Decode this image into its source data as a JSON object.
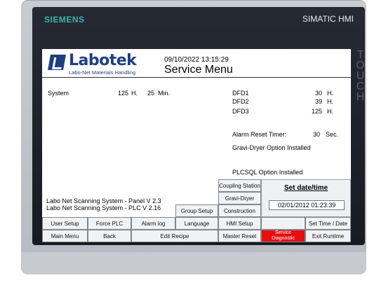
{
  "bezel": {
    "brand_left": "SIEMENS",
    "brand_right": "SIMATIC HMI",
    "side_label": "TOUCH"
  },
  "header": {
    "logo_name": "Labotek",
    "logo_tagline": "Labo-Net Materials Handling",
    "datetime": "09/10/2022 13:15:29",
    "title": "Service Menu"
  },
  "status": {
    "system_label": "System",
    "system_hours": "125",
    "hours_unit": "H.",
    "system_minutes": "25",
    "minutes_unit": "Min.",
    "dfd": [
      {
        "label": "DFD1",
        "value": "30",
        "unit": "H."
      },
      {
        "label": "DFD2",
        "value": "39",
        "unit": "H."
      },
      {
        "label": "DFD3",
        "value": "125",
        "unit": "H."
      }
    ],
    "alarm_label": "Alarm Reset Timer:",
    "alarm_value": "30",
    "alarm_unit": "Sec.",
    "gravi_option": "Gravi-Dryer Option Installed",
    "plcsql_option": "PLCSQL Option Installed"
  },
  "versions": {
    "panel": "Labo Net Scanning System - Panel V 2.3",
    "plc": "Labo Net Scanning System - PLC V 2.16"
  },
  "side_buttons": {
    "coupling": "Coupling Station",
    "gravi": "Gravi-Dryer",
    "construction": "Construction",
    "group_setup": "Group Setup"
  },
  "set_date": {
    "title": "Set date/time",
    "value": "02/01/2012 01:23:39"
  },
  "buttons_row1": {
    "user_setup": "User Setup",
    "force_plc": "Force PLC",
    "alarm_log": "Alarm log",
    "language": "Language",
    "hmi_setup": "HMI Setup",
    "set_time": "Set Time / Date"
  },
  "buttons_row2": {
    "main_menu": "Main Menu",
    "back": "Back",
    "edit_recipe": "Edit Recipe",
    "master_reset": "Master Reset",
    "service_diag_1": "Service",
    "service_diag_2": "Diagnostic",
    "exit_runtime": "Exit Runtime"
  },
  "colors": {
    "logo_blue": "#1f3f7f",
    "siemens_teal": "#3fb2aa",
    "alert_red": "#e80e0e"
  }
}
